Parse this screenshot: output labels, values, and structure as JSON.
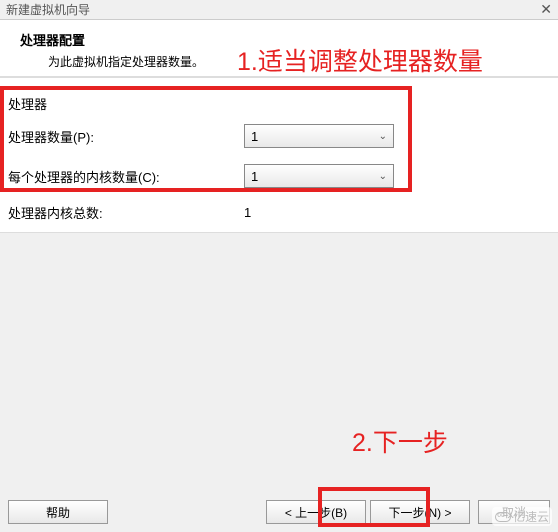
{
  "window": {
    "title": "新建虚拟机向导",
    "close": "✕"
  },
  "header": {
    "title": "处理器配置",
    "subtitle": "为此虚拟机指定处理器数量。"
  },
  "processor": {
    "section_label": "处理器",
    "count_label": "处理器数量(P):",
    "count_value": "1",
    "cores_label": "每个处理器的内核数量(C):",
    "cores_value": "1",
    "total_label": "处理器内核总数:",
    "total_value": "1"
  },
  "annotations": {
    "a1": "1.适当调整处理器数量",
    "a2": "2.下一步"
  },
  "footer": {
    "help": "帮助",
    "back": "< 上一步(B)",
    "next": "下一步(N) >",
    "cancel": "取消"
  },
  "watermark": {
    "text": "亿速云"
  }
}
